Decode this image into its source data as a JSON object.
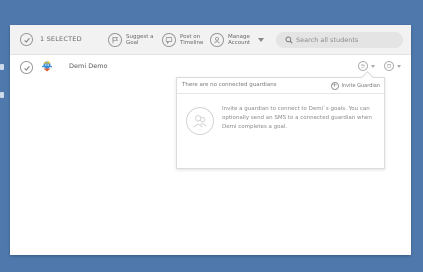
{
  "toolbar": {
    "selected_label": "1 SELECTED",
    "suggest_goal_label": "Suggest a Goal",
    "post_timeline_label": "Post on Timeline",
    "manage_account_label": "Manage Account",
    "search_placeholder": "Search all students"
  },
  "student_row": {
    "name": "Demi Demo"
  },
  "guardian_popup": {
    "no_guardians_message": "There are no connected guardians",
    "invite_button_label": "Invite Guardian",
    "description": "Invite a guardian to connect to Demi`s goals. You can optionally send an SMS to a connected guardian when Demi completes a goal."
  },
  "colors": {
    "background": "#4f79ad",
    "panel": "#ffffff",
    "toolbar": "#f2f2f2"
  }
}
